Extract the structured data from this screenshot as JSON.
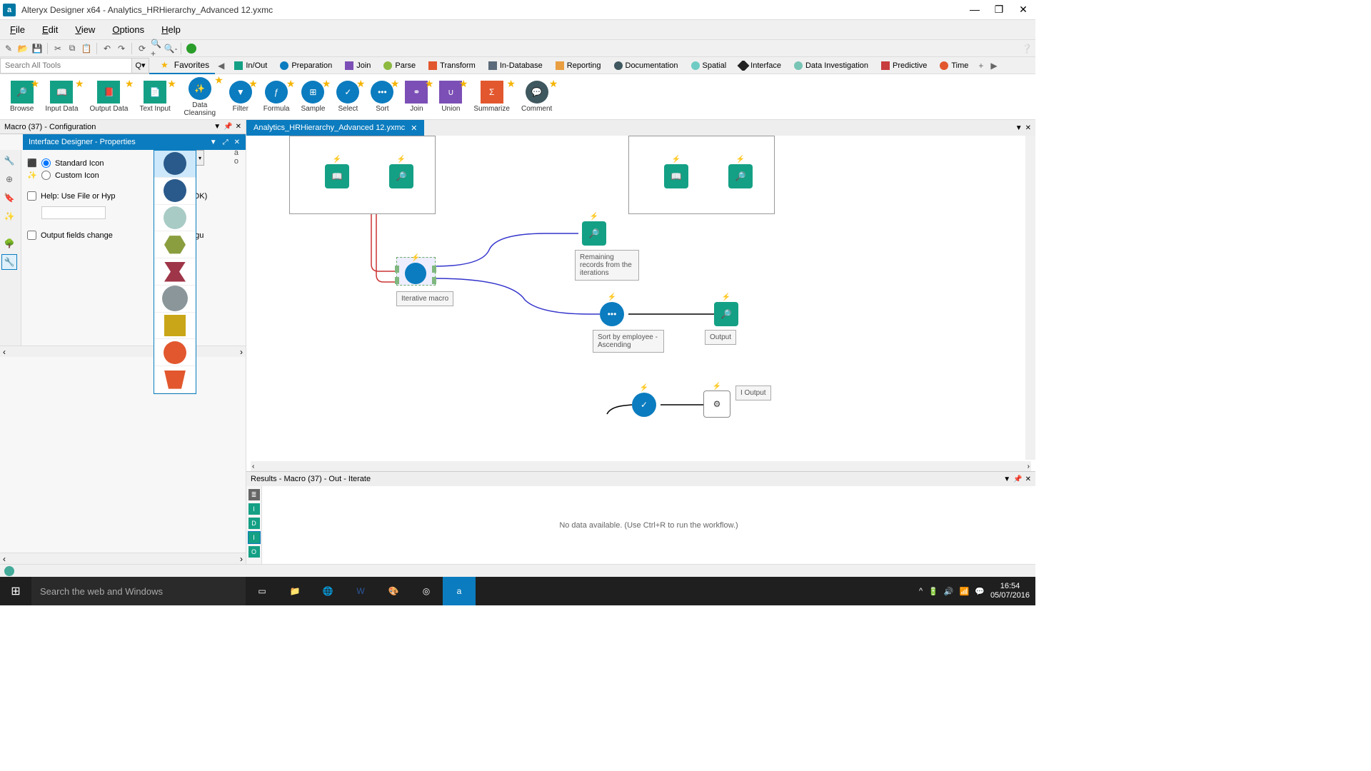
{
  "window": {
    "title": "Alteryx Designer x64 - Analytics_HRHierarchy_Advanced 12.yxmc"
  },
  "menu": {
    "file": "File",
    "edit": "Edit",
    "view": "View",
    "options": "Options",
    "help": "Help"
  },
  "search": {
    "placeholder": "Search All Tools",
    "favorites": "Favorites"
  },
  "categories": {
    "inout": "In/Out",
    "preparation": "Preparation",
    "join": "Join",
    "parse": "Parse",
    "transform": "Transform",
    "indatabase": "In-Database",
    "reporting": "Reporting",
    "documentation": "Documentation",
    "spatial": "Spatial",
    "interface": "Interface",
    "datainvestigation": "Data Investigation",
    "predictive": "Predictive",
    "time": "Time"
  },
  "tools": {
    "browse": "Browse",
    "inputdata": "Input Data",
    "outputdata": "Output Data",
    "textinput": "Text Input",
    "datacleansing": "Data Cleansing",
    "filter": "Filter",
    "formula": "Formula",
    "sample": "Sample",
    "select": "Select",
    "sort": "Sort",
    "join": "Join",
    "union": "Union",
    "summarize": "Summarize",
    "comment": "Comment"
  },
  "config": {
    "panel_title": "Macro (37) - Configuration",
    "designer_title": "Interface Designer - Properties",
    "standard_icon": "Standard Icon",
    "custom_icon": "Custom Icon",
    "help_label": "Help: Use File or Hyp",
    "help_suffix": "e paths OK)",
    "output_label": "Output fields change",
    "output_suffix": "cro's configu"
  },
  "doc": {
    "tab_name": "Analytics_HRHierarchy_Advanced 12.yxmc"
  },
  "canvas": {
    "iterative": "Iterative macro",
    "remaining": "Remaining records from the iterations",
    "sortby": "Sort by employee - Ascending",
    "output": "Output",
    "ioutput": "I Output"
  },
  "results": {
    "title": "Results - Macro (37) - Out - Iterate",
    "message": "No data available. (Use Ctrl+R to run the workflow.)"
  },
  "taskbar": {
    "search": "Search the web and Windows",
    "time": "16:54",
    "date": "05/07/2016"
  }
}
